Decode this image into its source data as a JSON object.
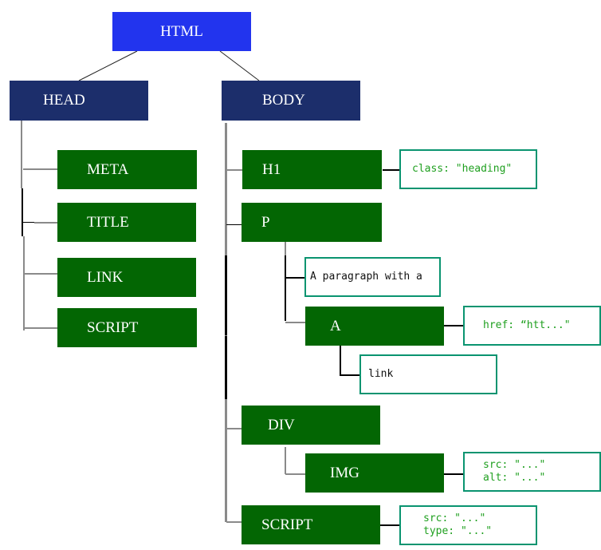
{
  "diagram": {
    "root": {
      "label": "HTML",
      "color": "#2234ee"
    },
    "head": {
      "label": "HEAD",
      "color": "#1c2e6b",
      "children": [
        {
          "label": "META"
        },
        {
          "label": "TITLE"
        },
        {
          "label": "LINK"
        },
        {
          "label": "SCRIPT"
        }
      ]
    },
    "body": {
      "label": "BODY",
      "color": "#1c2e6b",
      "children": {
        "h1": {
          "label": "H1",
          "attributes": "class: \"heading\""
        },
        "p": {
          "label": "P",
          "text": "A paragraph with a",
          "a": {
            "label": "A",
            "attributes": "href: “htt...\"",
            "text": "link"
          }
        },
        "div": {
          "label": "DIV",
          "img": {
            "label": "IMG",
            "attributes": [
              "src: \"...\"",
              "alt: \"...\""
            ]
          }
        },
        "script": {
          "label": "SCRIPT",
          "attributes": [
            "src: \"...\"",
            "type: \"...\""
          ]
        }
      }
    },
    "element_color": "#036603",
    "attribute_border_color": "#0a9470",
    "attribute_text_color": "#20a020"
  }
}
